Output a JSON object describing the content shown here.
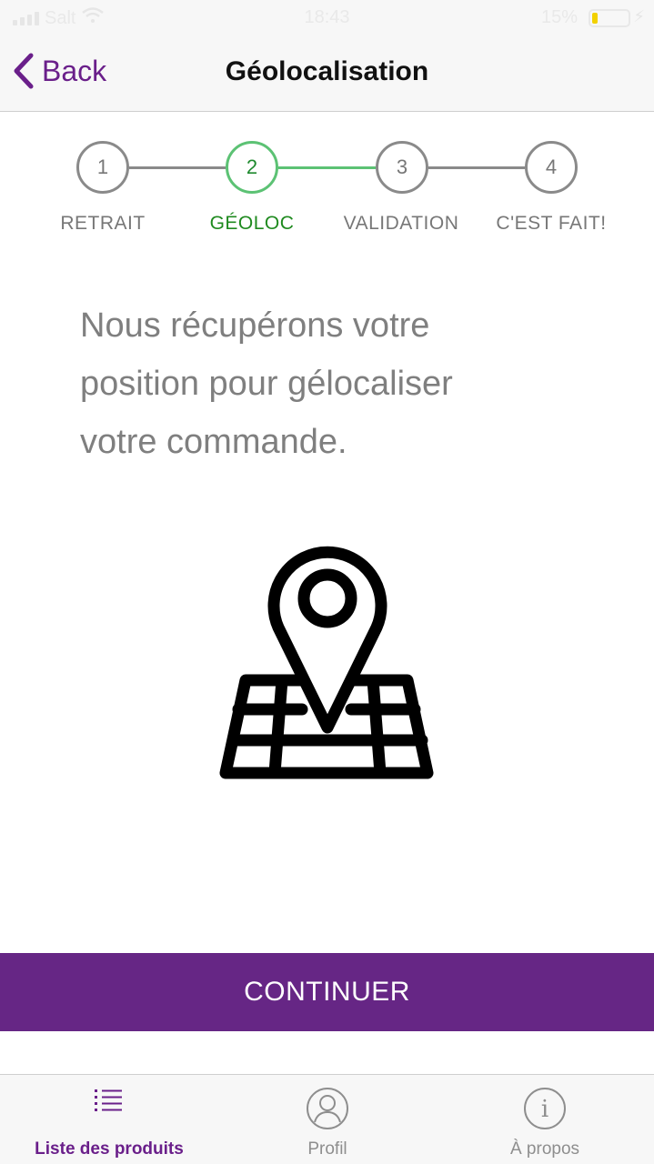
{
  "status_bar": {
    "carrier": "Salt",
    "time": "18:43",
    "battery_percent": "15%",
    "battery_level": 0.15,
    "icons": [
      "signal-icon",
      "wifi-icon",
      "battery-icon",
      "charging-bolt-icon"
    ]
  },
  "nav": {
    "back_label": "Back",
    "back_icon": "chevron-left-icon",
    "title": "Géolocalisation"
  },
  "stepper": {
    "steps": [
      {
        "number": "1",
        "label": "RETRAIT"
      },
      {
        "number": "2",
        "label": "GÉOLOC"
      },
      {
        "number": "3",
        "label": "VALIDATION"
      },
      {
        "number": "4",
        "label": "C'EST FAIT!"
      }
    ],
    "active_step": 2,
    "active_color": "#5cc274",
    "active_label_color": "#1f8a1f",
    "inactive_color": "#8a8a8a"
  },
  "message": {
    "line1": "Nous récupérons votre",
    "line2": "position pour gélocaliser",
    "line3": "votre commande."
  },
  "illustration": {
    "icon": "map-location-pin-icon"
  },
  "continue_button": {
    "label": "CONTINUER",
    "color": "#662685"
  },
  "tab_bar": {
    "tabs": [
      {
        "label": "Liste des produits",
        "icon": "list-icon",
        "selected": true
      },
      {
        "label": "Profil",
        "icon": "profile-icon",
        "selected": false
      },
      {
        "label": "À propos",
        "icon": "info-icon",
        "selected": false
      }
    ],
    "selected_color": "#6a1f8a"
  }
}
